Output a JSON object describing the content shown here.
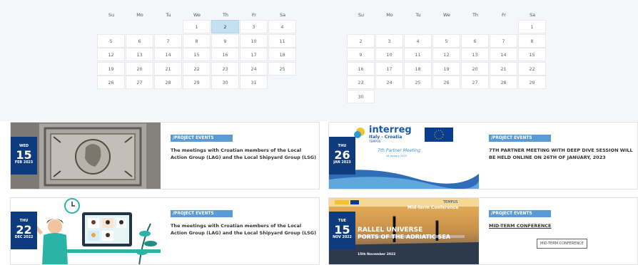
{
  "calendar": {
    "weekdays": [
      "Su",
      "Mo",
      "Tu",
      "We",
      "Th",
      "Fr",
      "Sa"
    ],
    "left": [
      [
        "",
        "",
        "",
        "1",
        "2",
        "3",
        "4"
      ],
      [
        "5",
        "6",
        "7",
        "8",
        "9",
        "10",
        "11"
      ],
      [
        "12",
        "13",
        "14",
        "15",
        "16",
        "17",
        "18"
      ],
      [
        "19",
        "20",
        "21",
        "22",
        "23",
        "24",
        "25"
      ],
      [
        "26",
        "27",
        "28",
        "29",
        "30",
        "31",
        ""
      ]
    ],
    "left_selected": "2",
    "right": [
      [
        "",
        "",
        "",
        "",
        "",
        "",
        "1"
      ],
      [
        "2",
        "3",
        "4",
        "5",
        "6",
        "7",
        "8"
      ],
      [
        "9",
        "10",
        "11",
        "12",
        "13",
        "14",
        "15"
      ],
      [
        "16",
        "17",
        "18",
        "19",
        "20",
        "21",
        "22"
      ],
      [
        "23",
        "24",
        "25",
        "26",
        "27",
        "28",
        "29"
      ],
      [
        "30",
        "",
        "",
        "",
        "",
        "",
        ""
      ]
    ]
  },
  "events": [
    {
      "dow": "WED",
      "day": "15",
      "month": "FEB 2023",
      "tag": "/PROJECT EVENTS",
      "title": "The meetings with Croatian members of the Local Action Group (LAG) and the Local Shipyard Group (LSG)"
    },
    {
      "dow": "THU",
      "day": "26",
      "month": "JAN 2023",
      "tag": "/PROJECT EVENTS",
      "title": "7TH PARTNER MEETING WITH DEEP DIVE SESSION WILL BE HELD ONLINE ON 26TH OF JANUARY, 2023",
      "img_text": {
        "brand": "interreg",
        "sub": "Italy - Croatia",
        "project": "TEMPUS",
        "heading": "7th Partner Meeting",
        "date": "26 January 2023"
      }
    },
    {
      "dow": "THU",
      "day": "22",
      "month": "DEC 2022",
      "tag": "/PROJECT EVENTS",
      "title": "The meetings with Croatian members of the Local Action Group (LAG) and the Local Shipyard Group (LSG)"
    },
    {
      "dow": "TUE",
      "day": "15",
      "month": "NOV 2022",
      "tag": "/PROJECT EVENTS",
      "title": "MID-TERM CONFERENCE",
      "button": "MID-TERM CONFERENCE",
      "img_text": {
        "project": "TEMPUS",
        "conf": "Mid-term Conference",
        "line1": "RALLEL UNIVERSE",
        "line2": "PORTS OF THE ADRIATIC SEA",
        "date": "15th November 2022"
      }
    }
  ]
}
